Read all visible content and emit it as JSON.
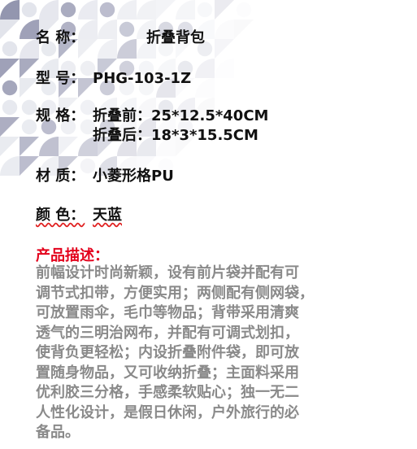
{
  "colors": {
    "label_text": "#111111",
    "heading_red": "#e3001b",
    "description_gray": "#8a8a8a",
    "pattern_dark": "#3b3f6e",
    "pattern_light": "#c9ccda"
  },
  "specs": {
    "name": {
      "label": "名 称：",
      "value": "折叠背包"
    },
    "model": {
      "label": "型 号：",
      "value": "PHG-103-1Z"
    },
    "size": {
      "label": "规 格：",
      "before": "折叠前：25*12.5*40CM",
      "after": "折叠后：18*3*15.5CM"
    },
    "material": {
      "label": "材 质：",
      "value": "小菱形格PU"
    },
    "color": {
      "label": "颜 色：",
      "value": "天蓝"
    }
  },
  "description": {
    "heading": "产品描述：",
    "lines": [
      "前幅设计时尚新颖，设有前片袋并配有可",
      "调节式扣带，方便实用；两侧配有侧网袋，",
      "可放置雨伞，毛巾等物品；背带采用清爽",
      "透气的三明治网布，并配有可调式划扣，",
      "使背负更轻松；内设折叠附件袋，即可放",
      "置随身物品，又可收纳折叠；主面料采用",
      "优利胶三分格，手感柔软贴心；独一无二",
      "人性化设计，是假日休闲，户外旅行的必",
      "备品。"
    ]
  }
}
